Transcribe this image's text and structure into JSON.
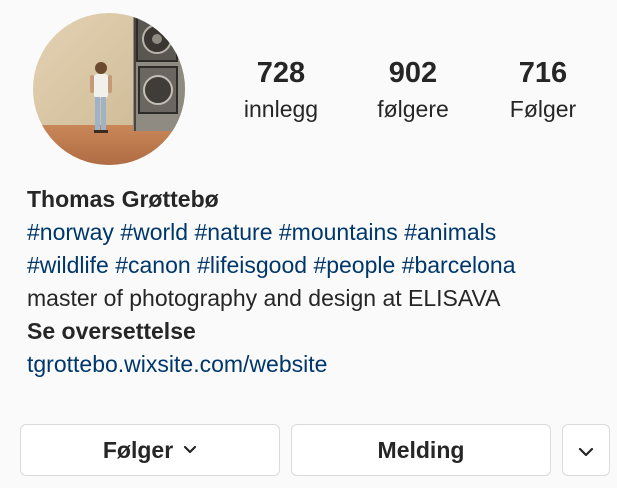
{
  "profile": {
    "name": "Thomas Grøttebø",
    "avatar_icon": "profile-photo"
  },
  "stats": {
    "posts": {
      "value": "728",
      "label": "innlegg"
    },
    "followers": {
      "value": "902",
      "label": "følgere"
    },
    "following": {
      "value": "716",
      "label": "Følger"
    }
  },
  "bio": {
    "hashtags_line1": [
      "#norway",
      "#world",
      "#nature",
      "#mountains",
      "#animals"
    ],
    "hashtags_line2": [
      "#wildlife",
      "#canon",
      "#lifeisgood",
      "#people",
      "#barcelona"
    ],
    "description": "master of photography and design at ELISAVA",
    "translate_label": "Se oversettelse",
    "website": "tgrottebo.wixsite.com/website"
  },
  "actions": {
    "following_label": "Følger",
    "message_label": "Melding",
    "more_icon": "chevron-down-icon"
  },
  "colors": {
    "background": "#fafafa",
    "text": "#262626",
    "link": "#00376b",
    "border": "#dbdbdb"
  }
}
